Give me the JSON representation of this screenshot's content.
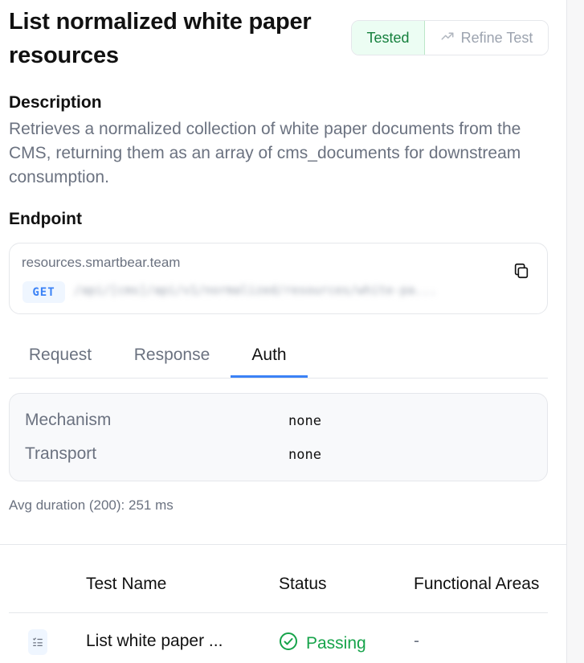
{
  "header": {
    "title": "List normalized white paper resources",
    "tested_label": "Tested",
    "refine_label": "Refine Test"
  },
  "description": {
    "heading": "Description",
    "text": "Retrieves a normalized collection of white paper documents from the CMS, returning them as an array of cms_documents for downstream consumption."
  },
  "endpoint": {
    "heading": "Endpoint",
    "host": "resources.smartbear.team",
    "method": "GET",
    "path": "/api/[cms]/api/v1/normalized/resources/white-pa..."
  },
  "tabs": [
    {
      "label": "Request",
      "active": false
    },
    {
      "label": "Response",
      "active": false
    },
    {
      "label": "Auth",
      "active": true
    }
  ],
  "auth": {
    "rows": [
      {
        "label": "Mechanism",
        "value": "none"
      },
      {
        "label": "Transport",
        "value": "none"
      }
    ]
  },
  "avg_duration": "Avg duration (200): 251 ms",
  "table": {
    "headers": [
      "Test Name",
      "Status",
      "Functional Areas"
    ],
    "rows": [
      {
        "icon": "list-check-icon",
        "name": "List white paper ...",
        "status": "Passing",
        "areas": "-"
      }
    ]
  },
  "colors": {
    "accent": "#3b82f6",
    "success": "#16a34a",
    "tested_bg": "#ecfdf3"
  },
  "icons": {
    "refine": "trending-up-icon",
    "copy": "copy-icon",
    "status": "check-circle-icon"
  }
}
